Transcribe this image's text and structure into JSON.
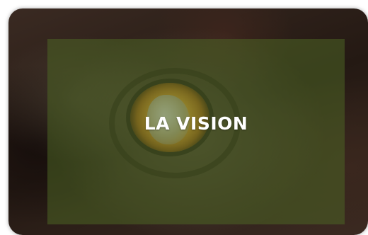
{
  "card": {
    "title": "LA VISION",
    "image_subject": "dog-eye-photo",
    "overlay_color": "#4c6424"
  }
}
